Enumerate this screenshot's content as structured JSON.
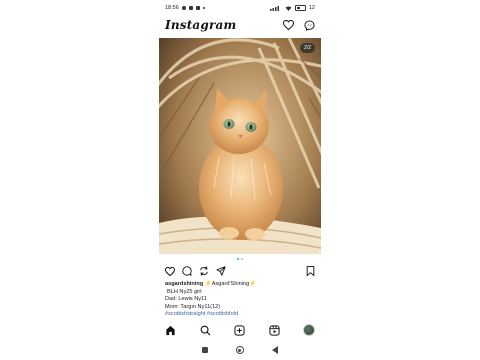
{
  "status_bar": {
    "time": "18:56",
    "battery": "12"
  },
  "header": {
    "logo": "Instagram"
  },
  "post": {
    "image_counter": "2/2",
    "carousel": {
      "total": 2,
      "active_index": 1
    },
    "caption": {
      "username": "asgardshining",
      "first_line_rest": "⚡Asgard'Shining⚡",
      "line2": "BLH Ny25 girl",
      "line3": "Dad: Lewis Ny11",
      "line4": "Mom: Targın Ny11(12)",
      "hashtags": "#scottishstraight #scottishfold"
    }
  },
  "icons": {
    "header": [
      "heart-icon",
      "messenger-icon"
    ],
    "actions": [
      "like-icon",
      "comment-icon",
      "repost-icon",
      "share-icon",
      "save-icon"
    ],
    "navbar": [
      "home-icon",
      "search-icon",
      "create-icon",
      "reels-icon",
      "profile-avatar"
    ],
    "system": [
      "recents-button",
      "home-button",
      "back-button"
    ]
  },
  "colors": {
    "hashtag": "#3b62a8",
    "active_dot": "#3897f0"
  }
}
